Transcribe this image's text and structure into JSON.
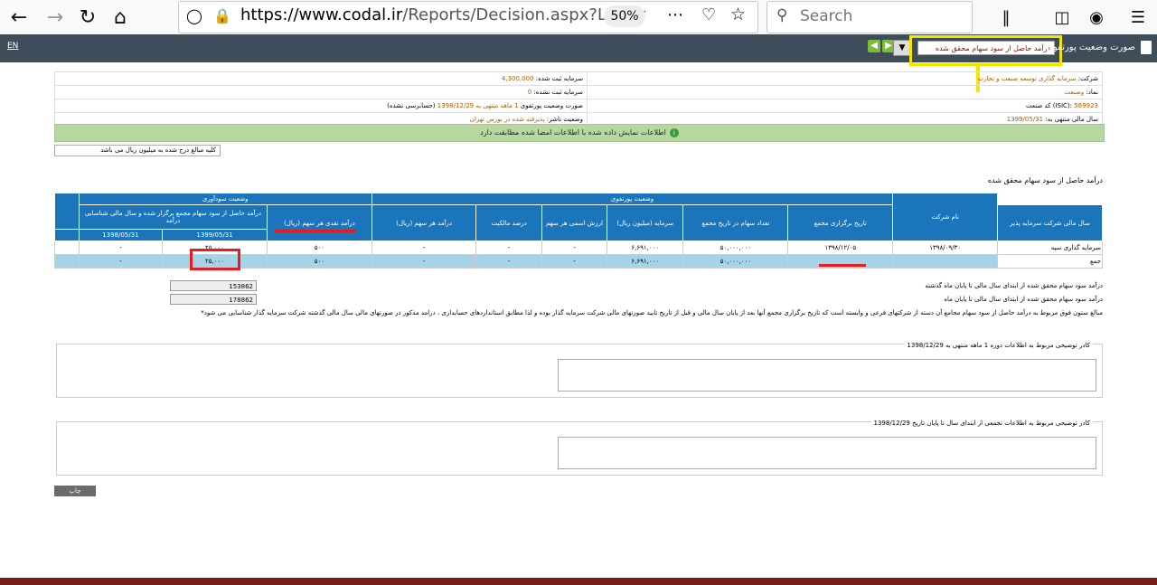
{
  "browser": {
    "url_host": "https://www.codal.ir",
    "url_path": "/Reports/Decision.aspx?Letter",
    "zoom": "50%",
    "search_placeholder": "Search"
  },
  "codal_header": {
    "lang": "EN",
    "report_title": "صورت وضعیت پورتفوی",
    "selected_option": "درآمد حاصل از سود سهام محقق شده"
  },
  "info": {
    "company_label": "شرکت:",
    "company_value": "سرمایه گذاری توسعه صنعت و تجارت",
    "symbol_label": "نماد:",
    "symbol_value": "وصنعت",
    "isic_label": "کد صنعت (ISIC):",
    "isic_value": "569923",
    "fiscal_label": "سال مالی منتهی به:",
    "fiscal_value": "1399/05/31",
    "reg_capital_label": "سرمایه ثبت شده:",
    "reg_capital_value": "4,300,000",
    "unreg_capital_label": "سرمایه ثبت نشده:",
    "unreg_capital_value": "0",
    "period_label": "صورت وضعیت پورتفوی",
    "period_value": "1 ماهه منتهی به 1398/12/29",
    "period_status": "(حسابرسی نشده)",
    "publisher_label": "وضعیت ناشر:",
    "publisher_value": "پذیرفته شده در بورس تهران"
  },
  "notice": "اطلاعات نمایش داده شده با اطلاعات امضا شده مطابقت دارد",
  "unit_note": "کلیه مبالغ درج شده به میلیون ریال می باشد",
  "section_title": "درآمد حاصل از سود سهام محقق شده",
  "table": {
    "group_company": "نام شرکت",
    "group_portfolio": "وضعیت پورتفوی",
    "group_profit": "وضعیت سودآوری",
    "h_fiscal": "سال مالی شرکت سرمایه پذیر",
    "h_meeting_date": "تاریخ برگزاری مجمع",
    "h_shares": "تعداد سهام در تاریخ مجمع",
    "h_capital": "سرمایه (میلیون ریال)",
    "h_nominal": "ارزش اسمی هر سهم",
    "h_ownership": "درصد مالکیت",
    "h_eps": "درآمد هر سهم (ریال)",
    "h_dps": "درآمد نقدی هر سهم (ریال)",
    "h_income": "درآمد حاصل از سود سهام مجمع برگزار شده و سال مالی شناسایی درآمد",
    "h_income_col1": "1399/05/31",
    "h_income_col2": "1398/05/31",
    "row": {
      "company": "سرمایه گذاری سپه",
      "fiscal": "۱۳۹۸/۰۹/۳۰",
      "meeting": "۱۳۹۸/۱۲/۰۵",
      "shares": "۵۰,۰۰۰,۰۰۰",
      "capital": "۶,۶۹۱,۰۰۰",
      "nominal": "-",
      "ownership": "-",
      "eps": "-",
      "dps": "۵۰۰",
      "income1": "۲۵,۰۰۰",
      "income2": "-"
    },
    "sum_row": {
      "label": "جمع",
      "shares": "۵۰,۰۰۰,۰۰۰",
      "capital": "۶,۶۹۱,۰۰۰",
      "nominal": "-",
      "ownership": "-",
      "eps": "-",
      "dps": "۵۰۰",
      "income1": "۲۵,۰۰۰",
      "income2": "-"
    }
  },
  "notes": {
    "line1": "درآمد سود سهام محقق شده از ابتدای سال مالی تا پایان ماه گذشته",
    "value1": "153862",
    "line2": "درآمد سود سهام محقق شده از ابتدای سال مالی تا پایان ماه",
    "value2": "178862",
    "line3": "*مبالغ ستون فوق مربوط به درآمد حاصل از سود سهام مجامع آن دسته از شرکتهای فرعی و وابسته است که تاریخ برگزاری مجمع آنها بعد از پایان سال مالی و قبل از تاریخ تایید صورتهای مالی شرکت سرمایه گذار بوده و لذا مطابق استانداردهای حسابداری ، درامد مذکور در صورتهای مالی سال مالی گذشته شرکت سرمایه گذار شناسایی می شود"
  },
  "frames": {
    "frame1_title": "کادر توضیحی مربوط به اطلاعات دوره 1 ماهه منتهی به 1398/12/29",
    "frame2_title": "کادر توضیحی مربوط به اطلاعات تجمعی از ابتدای سال تا پایان تاریخ 1398/12/29"
  },
  "print_label": "چاپ"
}
